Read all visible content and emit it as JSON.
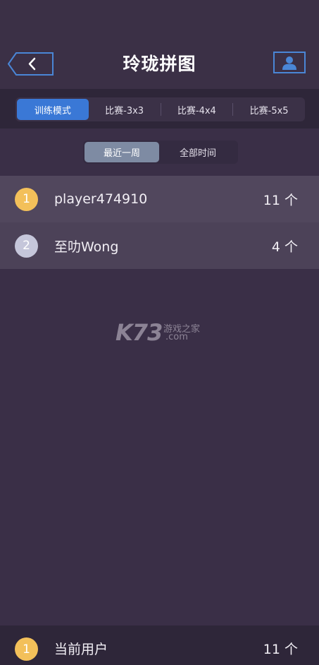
{
  "header": {
    "title": "玲珑拼图",
    "back_icon": "chevron-left-icon",
    "user_icon": "person-icon"
  },
  "modes": [
    {
      "label": "训练模式",
      "active": true
    },
    {
      "label": "比赛-3x3",
      "active": false
    },
    {
      "label": "比赛-4x4",
      "active": false
    },
    {
      "label": "比赛-5x5",
      "active": false
    }
  ],
  "time_filter": [
    {
      "label": "最近一周",
      "active": true
    },
    {
      "label": "全部时间",
      "active": false
    }
  ],
  "leaderboard": [
    {
      "rank": "1",
      "name": "player474910",
      "count": "11 个"
    },
    {
      "rank": "2",
      "name": "至叻Wong",
      "count": "4 个"
    }
  ],
  "watermark": {
    "logo": "K73",
    "cn": "游戏之家",
    "domain": ".com"
  },
  "current_user": {
    "rank": "1",
    "name": "当前用户",
    "count": "11 个"
  },
  "colors": {
    "accent": "#3a78d6",
    "gold": "#f3c05a",
    "silver": "#c5c6da",
    "background": "#3a2f47"
  }
}
